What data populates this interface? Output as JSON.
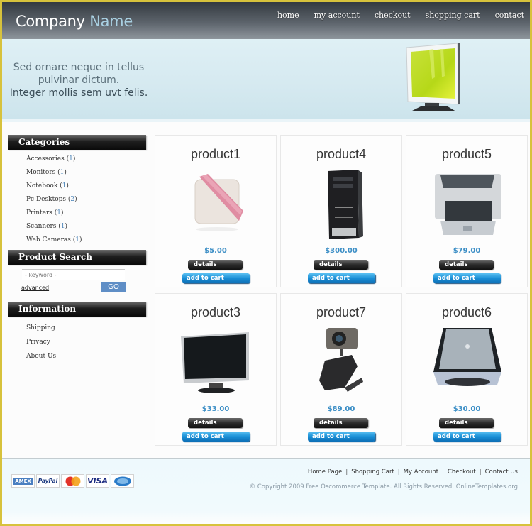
{
  "header": {
    "logo_main": "Company",
    "logo_accent": "Name",
    "nav": [
      "home",
      "my account",
      "checkout",
      "shopping cart",
      "contact"
    ]
  },
  "banner": {
    "line1": "Sed ornare neque in tellus",
    "line2": "pulvinar dictum.",
    "line3": "Integer mollis sem uvt felis.",
    "image": "monitor-icon"
  },
  "sidebar": {
    "categories": {
      "title": "Categories",
      "items": [
        {
          "label": "Accessories",
          "count": "1"
        },
        {
          "label": "Monitors",
          "count": "1"
        },
        {
          "label": "Notebook",
          "count": "1"
        },
        {
          "label": "Pc Desktops",
          "count": "2"
        },
        {
          "label": "Printers",
          "count": "1"
        },
        {
          "label": "Scanners",
          "count": "1"
        },
        {
          "label": "Web Cameras",
          "count": "1"
        }
      ]
    },
    "search": {
      "title": "Product Search",
      "placeholder": "- keyword -",
      "advanced_label": "advanced",
      "go_label": "GO"
    },
    "information": {
      "title": "Information",
      "items": [
        "Shipping",
        "Privacy",
        "About Us"
      ]
    }
  },
  "products": [
    {
      "name": "product1",
      "price": "$5.00",
      "image": "bag-icon",
      "details_label": "details",
      "cart_label": "add to cart"
    },
    {
      "name": "product4",
      "price": "$300.00",
      "image": "pc-tower-icon",
      "details_label": "details",
      "cart_label": "add to cart"
    },
    {
      "name": "product5",
      "price": "$79.00",
      "image": "printer-icon",
      "details_label": "details",
      "cart_label": "add to cart"
    },
    {
      "name": "product3",
      "price": "$33.00",
      "image": "monitor-icon",
      "details_label": "details",
      "cart_label": "add to cart"
    },
    {
      "name": "product7",
      "price": "$89.00",
      "image": "webcam-icon",
      "details_label": "details",
      "cart_label": "add to cart"
    },
    {
      "name": "product6",
      "price": "$30.00",
      "image": "scanner-icon",
      "details_label": "details",
      "cart_label": "add to cart"
    }
  ],
  "footer": {
    "payment_cards": [
      "AMEX",
      "PayPal",
      "MasterCard",
      "VISA",
      "Cirrus"
    ],
    "links": [
      "Home Page",
      "Shopping Cart",
      "My Account",
      "Checkout",
      "Contact Us"
    ],
    "separator": "|",
    "copyright": "© Copyright 2009 Free Oscommerce Template. All Rights Reserved. OnlineTemplates.org"
  },
  "colors": {
    "frame": "#d7c23c",
    "price": "#3d8fc6",
    "go_button": "#5f8ec6",
    "add_to_cart": "#1a8fd6"
  }
}
